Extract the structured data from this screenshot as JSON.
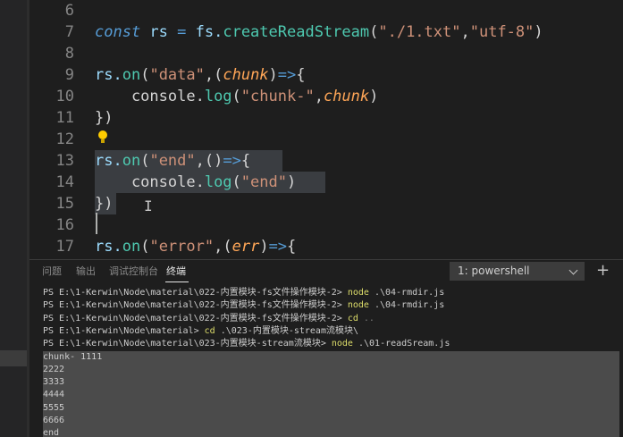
{
  "editor": {
    "lines": [
      {
        "n": "6",
        "tokens": []
      },
      {
        "n": "7",
        "tokens": [
          {
            "t": "const",
            "c": "kw"
          },
          {
            "t": " rs ",
            "c": "var"
          },
          {
            "t": "=",
            "c": "arr"
          },
          {
            "t": " fs.",
            "c": "var"
          },
          {
            "t": "createReadStream",
            "c": "fn"
          },
          {
            "t": "(",
            "c": "pun"
          },
          {
            "t": "\"./1.txt\"",
            "c": "str"
          },
          {
            "t": ",",
            "c": "pun"
          },
          {
            "t": "\"utf-8\"",
            "c": "str"
          },
          {
            "t": ")",
            "c": "pun"
          }
        ]
      },
      {
        "n": "8",
        "tokens": []
      },
      {
        "n": "9",
        "tokens": [
          {
            "t": "rs.",
            "c": "var"
          },
          {
            "t": "on",
            "c": "fn"
          },
          {
            "t": "(",
            "c": "pun"
          },
          {
            "t": "\"data\"",
            "c": "str"
          },
          {
            "t": ",(",
            "c": "pun"
          },
          {
            "t": "chunk",
            "c": "par"
          },
          {
            "t": ")",
            "c": "pun"
          },
          {
            "t": "=>",
            "c": "arr"
          },
          {
            "t": "{",
            "c": "pun"
          }
        ]
      },
      {
        "n": "10",
        "tokens": [
          {
            "t": "    console.",
            "c": "pun"
          },
          {
            "t": "log",
            "c": "fn"
          },
          {
            "t": "(",
            "c": "pun"
          },
          {
            "t": "\"chunk-\"",
            "c": "str"
          },
          {
            "t": ",",
            "c": "pun"
          },
          {
            "t": "chunk",
            "c": "par"
          },
          {
            "t": ")",
            "c": "pun"
          }
        ]
      },
      {
        "n": "11",
        "tokens": [
          {
            "t": "})",
            "c": "pun"
          }
        ]
      },
      {
        "n": "12",
        "tokens": []
      },
      {
        "n": "13",
        "tokens": [
          {
            "t": "rs.",
            "c": "var"
          },
          {
            "t": "on",
            "c": "fn"
          },
          {
            "t": "(",
            "c": "pun"
          },
          {
            "t": "\"end\"",
            "c": "str"
          },
          {
            "t": ",()",
            "c": "pun"
          },
          {
            "t": "=>",
            "c": "arr"
          },
          {
            "t": "{",
            "c": "pun"
          }
        ]
      },
      {
        "n": "14",
        "tokens": [
          {
            "t": "    console.",
            "c": "pun"
          },
          {
            "t": "log",
            "c": "fn"
          },
          {
            "t": "(",
            "c": "pun"
          },
          {
            "t": "\"end\"",
            "c": "str"
          },
          {
            "t": ")",
            "c": "pun"
          }
        ]
      },
      {
        "n": "15",
        "tokens": [
          {
            "t": "})",
            "c": "pun"
          }
        ]
      },
      {
        "n": "16",
        "tokens": []
      },
      {
        "n": "17",
        "tokens": [
          {
            "t": "rs.",
            "c": "var"
          },
          {
            "t": "on",
            "c": "fn"
          },
          {
            "t": "(",
            "c": "pun"
          },
          {
            "t": "\"error\"",
            "c": "str"
          },
          {
            "t": ",(",
            "c": "pun"
          },
          {
            "t": "err",
            "c": "par"
          },
          {
            "t": ")",
            "c": "pun"
          },
          {
            "t": "=>",
            "c": "arr"
          },
          {
            "t": "{",
            "c": "pun"
          }
        ]
      }
    ]
  },
  "panel": {
    "tabs": {
      "problems": "问题",
      "output": "输出",
      "debug_console": "调试控制台",
      "terminal": "终端"
    },
    "terminal_select": "1: powershell",
    "add_icon": "+",
    "terminal_lines": [
      {
        "prefix": "PS E:\\1-Kerwin\\Node\\material\\022-内置模块-fs文件操作模块-2> ",
        "cmd": "node",
        "arg": " .\\04-rmdir.js",
        "tail": ""
      },
      {
        "prefix": "PS E:\\1-Kerwin\\Node\\material\\022-内置模块-fs文件操作模块-2> ",
        "cmd": "node",
        "arg": " .\\04-rmdir.js",
        "tail": ""
      },
      {
        "prefix": "PS E:\\1-Kerwin\\Node\\material\\022-内置模块-fs文件操作模块-2> ",
        "cmd": "cd",
        "arg": " ",
        "tail": ".."
      },
      {
        "prefix": "PS E:\\1-Kerwin\\Node\\material> ",
        "cmd": "cd",
        "arg": " .\\023-内置模块-stream流模块\\",
        "tail": ""
      },
      {
        "prefix": "PS E:\\1-Kerwin\\Node\\material\\023-内置模块-stream流模块> ",
        "cmd": "node",
        "arg": " .\\01-readSream.js",
        "tail": ""
      }
    ],
    "output_lines": [
      "chunk- 1111",
      "2222",
      "3333",
      "4444",
      "5555",
      "6666",
      "end"
    ]
  }
}
